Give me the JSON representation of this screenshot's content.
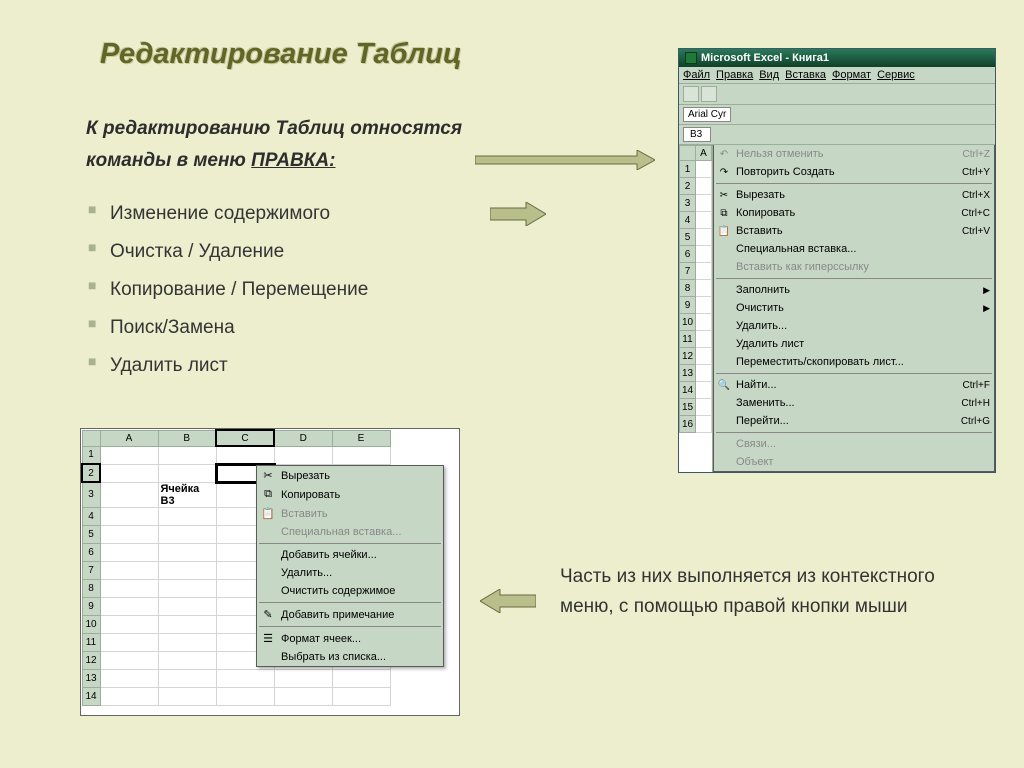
{
  "title": "Редактирование Таблиц",
  "subtitle_line1": "К редактированию Таблиц относятся",
  "subtitle_line2_prefix": "команды  в меню ",
  "subtitle_emph": "ПРАВКА:",
  "bullets": [
    "Изменение содержимого",
    "Очистка / Удаление",
    "Копирование / Перемещение",
    "Поиск/Замена",
    "Удалить лист"
  ],
  "right_text": "Часть из них выполняется  из контекстного меню, с помощью правой кнопки мыши",
  "excel": {
    "window_title": "Microsoft Excel - Книга1",
    "menubar": [
      "Файл",
      "Правка",
      "Вид",
      "Вставка",
      "Формат",
      "Сервис"
    ],
    "font": "Arial Cyr",
    "cell_ref": "B3",
    "col_header": "A",
    "rows": [
      "1",
      "2",
      "3",
      "4",
      "5",
      "6",
      "7",
      "8",
      "9",
      "10",
      "11",
      "12",
      "13",
      "14",
      "15",
      "16"
    ],
    "edit_menu": [
      {
        "type": "item",
        "icon": "↶",
        "label": "Нельзя отменить",
        "shortcut": "Ctrl+Z",
        "disabled": true
      },
      {
        "type": "item",
        "icon": "↷",
        "label": "Повторить Создать",
        "shortcut": "Ctrl+Y",
        "disabled": false
      },
      {
        "type": "sep"
      },
      {
        "type": "item",
        "icon": "✂",
        "label": "Вырезать",
        "shortcut": "Ctrl+X",
        "disabled": false
      },
      {
        "type": "item",
        "icon": "⧉",
        "label": "Копировать",
        "shortcut": "Ctrl+C",
        "disabled": false
      },
      {
        "type": "item",
        "icon": "📋",
        "label": "Вставить",
        "shortcut": "Ctrl+V",
        "disabled": false
      },
      {
        "type": "item",
        "icon": "",
        "label": "Специальная вставка...",
        "shortcut": "",
        "disabled": false
      },
      {
        "type": "item",
        "icon": "",
        "label": "Вставить как гиперссылку",
        "shortcut": "",
        "disabled": true
      },
      {
        "type": "sep"
      },
      {
        "type": "item",
        "icon": "",
        "label": "Заполнить",
        "shortcut": "",
        "arrow": true
      },
      {
        "type": "item",
        "icon": "",
        "label": "Очистить",
        "shortcut": "",
        "arrow": true
      },
      {
        "type": "item",
        "icon": "",
        "label": "Удалить...",
        "shortcut": ""
      },
      {
        "type": "item",
        "icon": "",
        "label": "Удалить лист",
        "shortcut": ""
      },
      {
        "type": "item",
        "icon": "",
        "label": "Переместить/скопировать лист...",
        "shortcut": ""
      },
      {
        "type": "sep"
      },
      {
        "type": "item",
        "icon": "🔍",
        "label": "Найти...",
        "shortcut": "Ctrl+F"
      },
      {
        "type": "item",
        "icon": "",
        "label": "Заменить...",
        "shortcut": "Ctrl+H"
      },
      {
        "type": "item",
        "icon": "",
        "label": "Перейти...",
        "shortcut": "Ctrl+G"
      },
      {
        "type": "sep"
      },
      {
        "type": "item",
        "icon": "",
        "label": "Связи...",
        "shortcut": "",
        "disabled": true
      },
      {
        "type": "item",
        "icon": "",
        "label": "Объект",
        "shortcut": "",
        "disabled": true
      }
    ]
  },
  "ctx": {
    "cols": [
      "A",
      "B",
      "C",
      "D",
      "E"
    ],
    "rows": [
      "1",
      "2",
      "3",
      "4",
      "5",
      "6",
      "7",
      "8",
      "9",
      "10",
      "11",
      "12",
      "13",
      "14"
    ],
    "cell_b3": "Ячейка В3",
    "menu": [
      {
        "type": "item",
        "icon": "✂",
        "label": "Вырезать"
      },
      {
        "type": "item",
        "icon": "⧉",
        "label": "Копировать"
      },
      {
        "type": "item",
        "icon": "📋",
        "label": "Вставить",
        "disabled": true
      },
      {
        "type": "item",
        "icon": "",
        "label": "Специальная вставка...",
        "disabled": true
      },
      {
        "type": "sep"
      },
      {
        "type": "item",
        "icon": "",
        "label": "Добавить ячейки..."
      },
      {
        "type": "item",
        "icon": "",
        "label": "Удалить..."
      },
      {
        "type": "item",
        "icon": "",
        "label": "Очистить содержимое"
      },
      {
        "type": "sep"
      },
      {
        "type": "item",
        "icon": "✎",
        "label": "Добавить примечание"
      },
      {
        "type": "sep"
      },
      {
        "type": "item",
        "icon": "☰",
        "label": "Формат ячеек..."
      },
      {
        "type": "item",
        "icon": "",
        "label": "Выбрать из списка..."
      }
    ]
  }
}
